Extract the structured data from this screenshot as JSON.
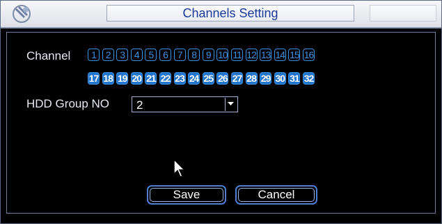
{
  "window": {
    "title": "Channels Setting"
  },
  "channel": {
    "label": "Channel",
    "row1": [
      "1",
      "2",
      "3",
      "4",
      "5",
      "6",
      "7",
      "8",
      "9",
      "10",
      "11",
      "12",
      "13",
      "14",
      "15",
      "16"
    ],
    "row2": [
      "17",
      "18",
      "19",
      "20",
      "21",
      "22",
      "23",
      "24",
      "25",
      "26",
      "27",
      "28",
      "29",
      "30",
      "31",
      "32"
    ]
  },
  "hdd_group": {
    "label": "HDD Group NO",
    "value": "2"
  },
  "buttons": {
    "save": "Save",
    "cancel": "Cancel"
  },
  "colors": {
    "accent": "#2275cf",
    "title_text": "#1a3a9a"
  }
}
